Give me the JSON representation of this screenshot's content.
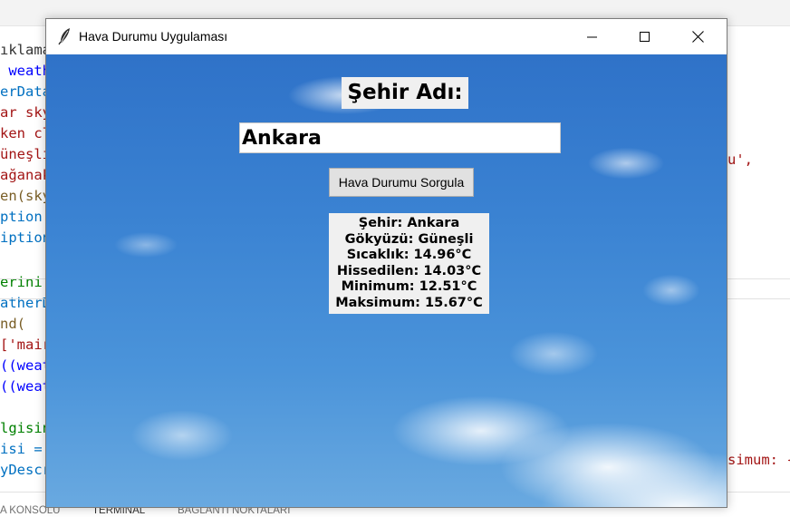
{
  "editor": {
    "lines": [
      {
        "text": "ıklama",
        "color": "#333333"
      },
      {
        "text": " weath",
        "color": "#0000ff"
      },
      {
        "text": "erData",
        "color": "#0070c1"
      },
      {
        "text": "ar sky",
        "color": "#a31515"
      },
      {
        "text": "ken cl",
        "color": "#a31515"
      },
      {
        "text": "üneşli",
        "color": "#a31515"
      },
      {
        "text": "ağanak",
        "color": "#a31515"
      },
      {
        "text": "en(sky",
        "color": "#795e26"
      },
      {
        "text": "ption",
        "color": "#0070c1"
      },
      {
        "text": "iption",
        "color": "#0070c1"
      },
      {
        "text": "",
        "color": "#333333"
      },
      {
        "text": "erini",
        "color": "#008000"
      },
      {
        "text": "atherD",
        "color": "#0070c1"
      },
      {
        "text": "nd(",
        "color": "#795e26"
      },
      {
        "text": "['mair",
        "color": "#a31515"
      },
      {
        "text": "((weat",
        "color": "#0000ff"
      },
      {
        "text": "((weat",
        "color": "#0000ff"
      },
      {
        "text": "",
        "color": "#333333"
      },
      {
        "text": "lgisin",
        "color": "#008000"
      },
      {
        "text": "isi =",
        "color": "#0070c1"
      },
      {
        "text": "yDescr",
        "color": "#0070c1"
      }
    ],
    "right_snippets": {
      "comma": "u',",
      "maksimum": "simum: {"
    },
    "panel_tabs": [
      "A KONSOLU",
      "TERMİNAL",
      "BAĞLANTI NOKTALARI"
    ],
    "colors": {
      "keyword": "#0000ff",
      "string": "#a31515",
      "comment": "#008000",
      "variable": "#0070c1",
      "function": "#795e26"
    }
  },
  "window": {
    "title": "Hava Durumu Uygulaması",
    "icons": {
      "app": "feather-icon",
      "minimize": "minimize-icon",
      "maximize": "maximize-icon",
      "close": "close-icon"
    },
    "city_label": "Şehir Adı:",
    "city_input_value": "Ankara",
    "query_button_label": "Hava Durumu Sorgula",
    "result": {
      "city": "Şehir: Ankara",
      "sky": "Gökyüzü: Güneşli",
      "temperature": "Sıcaklık: 14.96°C",
      "feels_like": "Hissedilen: 14.03°C",
      "minimum": "Minimum: 12.51°C",
      "maximum": "Maksimum: 15.67°C"
    },
    "colors": {
      "sky_top": "#2f72c8",
      "sky_bottom": "#69a9e0",
      "panel": "#f0f0f0",
      "button": "#e1e1e1"
    }
  }
}
